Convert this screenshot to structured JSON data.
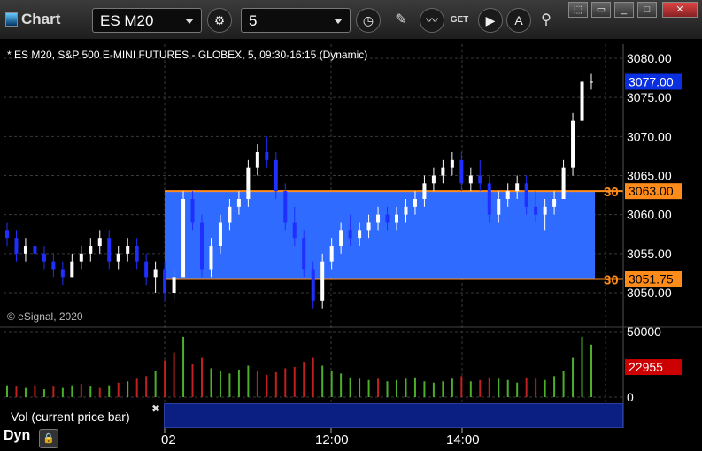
{
  "window": {
    "title": "Chart"
  },
  "toolbar": {
    "symbol": "ES M20",
    "interval": "5",
    "icons": [
      "gear-icon",
      "clock-icon",
      "pencil-icon",
      "line-study-icon",
      "get-icon",
      "play-icon",
      "alert-icon",
      "link-icon"
    ],
    "get_label": "GET"
  },
  "chart": {
    "header": "* ES M20, S&P 500 E-MINI FUTURES - GLOBEX, 5, 09:30-16:15 (Dynamic)",
    "copyright": "© eSignal, 2020",
    "price_axis": [
      "3080.00",
      "3075.00",
      "3070.00",
      "3065.00",
      "3060.00",
      "3055.00",
      "3050.00"
    ],
    "last_price": "3077.00",
    "levels": [
      {
        "left_label": "30",
        "value": "3063.00",
        "color": "#ff8c1a"
      },
      {
        "left_label": "30",
        "value": "3051.75",
        "color": "#ff8c1a"
      }
    ],
    "volume_axis": [
      "50000",
      "0"
    ],
    "volume_value": "22955",
    "time_axis": [
      "02",
      "12:00",
      "14:00"
    ],
    "colors": {
      "up": "#ffffff",
      "down": "#1f2fff",
      "zone": "#2f6bff",
      "last": "#0a2fe0",
      "vol_badge": "#cc0000",
      "vol_up": "#4caf2a",
      "vol_down": "#c02020"
    }
  },
  "chart_data": {
    "type": "candlestick",
    "ylim": [
      3047,
      3082
    ],
    "zone": [
      3051.75,
      3063.0
    ],
    "candles": [
      [
        3058,
        3059,
        3056,
        3057
      ],
      [
        3057,
        3058,
        3054,
        3055
      ],
      [
        3055,
        3057,
        3054,
        3056
      ],
      [
        3056,
        3057,
        3054,
        3055
      ],
      [
        3055,
        3056,
        3053,
        3054
      ],
      [
        3054,
        3055,
        3052,
        3053
      ],
      [
        3053,
        3054,
        3051,
        3052
      ],
      [
        3052,
        3055,
        3052,
        3054
      ],
      [
        3054,
        3056,
        3053,
        3055
      ],
      [
        3055,
        3057,
        3054,
        3056
      ],
      [
        3056,
        3058,
        3055,
        3057
      ],
      [
        3057,
        3058,
        3053,
        3054
      ],
      [
        3054,
        3056,
        3053,
        3055
      ],
      [
        3055,
        3057,
        3054,
        3056
      ],
      [
        3056,
        3057,
        3053,
        3054
      ],
      [
        3054,
        3055,
        3051,
        3052
      ],
      [
        3052,
        3054,
        3050,
        3053
      ],
      [
        3053,
        3054,
        3049,
        3050
      ],
      [
        3050,
        3053,
        3049,
        3052
      ],
      [
        3052,
        3063,
        3052,
        3062
      ],
      [
        3062,
        3063,
        3058,
        3059
      ],
      [
        3059,
        3060,
        3052,
        3053
      ],
      [
        3053,
        3057,
        3052,
        3056
      ],
      [
        3056,
        3060,
        3055,
        3059
      ],
      [
        3059,
        3062,
        3058,
        3061
      ],
      [
        3061,
        3063,
        3060,
        3062
      ],
      [
        3062,
        3067,
        3061,
        3066
      ],
      [
        3066,
        3069,
        3065,
        3068
      ],
      [
        3068,
        3070,
        3066,
        3067
      ],
      [
        3067,
        3068,
        3062,
        3063
      ],
      [
        3063,
        3064,
        3058,
        3059
      ],
      [
        3059,
        3061,
        3056,
        3057
      ],
      [
        3057,
        3058,
        3052,
        3053
      ],
      [
        3053,
        3054,
        3048,
        3049
      ],
      [
        3049,
        3055,
        3048,
        3054
      ],
      [
        3054,
        3057,
        3053,
        3056
      ],
      [
        3056,
        3059,
        3055,
        3058
      ],
      [
        3058,
        3060,
        3056,
        3057
      ],
      [
        3057,
        3059,
        3056,
        3058
      ],
      [
        3058,
        3060,
        3057,
        3059
      ],
      [
        3059,
        3061,
        3058,
        3060
      ],
      [
        3060,
        3061,
        3058,
        3059
      ],
      [
        3059,
        3061,
        3058,
        3060
      ],
      [
        3060,
        3062,
        3059,
        3061
      ],
      [
        3061,
        3063,
        3060,
        3062
      ],
      [
        3062,
        3065,
        3061,
        3064
      ],
      [
        3064,
        3066,
        3063,
        3065
      ],
      [
        3065,
        3067,
        3064,
        3066
      ],
      [
        3066,
        3068,
        3065,
        3067
      ],
      [
        3067,
        3068,
        3063,
        3064
      ],
      [
        3064,
        3066,
        3063,
        3065
      ],
      [
        3065,
        3067,
        3063,
        3064
      ],
      [
        3064,
        3065,
        3059,
        3060
      ],
      [
        3060,
        3063,
        3059,
        3062
      ],
      [
        3062,
        3064,
        3061,
        3063
      ],
      [
        3063,
        3065,
        3062,
        3064
      ],
      [
        3064,
        3065,
        3060,
        3061
      ],
      [
        3061,
        3063,
        3059,
        3060
      ],
      [
        3060,
        3062,
        3058,
        3061
      ],
      [
        3061,
        3063,
        3060,
        3062
      ],
      [
        3062,
        3067,
        3062,
        3066
      ],
      [
        3066,
        3073,
        3065,
        3072
      ],
      [
        3072,
        3078,
        3071,
        3077
      ],
      [
        3077,
        3078,
        3076,
        3077
      ]
    ],
    "volume": [
      [
        9000,
        1
      ],
      [
        8000,
        0
      ],
      [
        7000,
        1
      ],
      [
        9000,
        0
      ],
      [
        6000,
        1
      ],
      [
        8000,
        0
      ],
      [
        7000,
        1
      ],
      [
        9000,
        1
      ],
      [
        10000,
        0
      ],
      [
        8000,
        1
      ],
      [
        7000,
        0
      ],
      [
        9000,
        1
      ],
      [
        11000,
        0
      ],
      [
        12000,
        1
      ],
      [
        14000,
        0
      ],
      [
        16000,
        0
      ],
      [
        20000,
        1
      ],
      [
        28000,
        0
      ],
      [
        34000,
        0
      ],
      [
        46000,
        1
      ],
      [
        25000,
        0
      ],
      [
        30000,
        0
      ],
      [
        22000,
        1
      ],
      [
        20000,
        1
      ],
      [
        18000,
        1
      ],
      [
        21000,
        1
      ],
      [
        24000,
        1
      ],
      [
        20000,
        0
      ],
      [
        17000,
        0
      ],
      [
        19000,
        0
      ],
      [
        22000,
        0
      ],
      [
        23000,
        0
      ],
      [
        27000,
        0
      ],
      [
        30000,
        0
      ],
      [
        24000,
        1
      ],
      [
        20000,
        1
      ],
      [
        18000,
        1
      ],
      [
        15000,
        1
      ],
      [
        14000,
        1
      ],
      [
        13000,
        1
      ],
      [
        14000,
        0
      ],
      [
        12000,
        1
      ],
      [
        13000,
        1
      ],
      [
        14000,
        1
      ],
      [
        15000,
        1
      ],
      [
        12000,
        1
      ],
      [
        11000,
        1
      ],
      [
        12000,
        1
      ],
      [
        14000,
        1
      ],
      [
        16000,
        0
      ],
      [
        12000,
        1
      ],
      [
        13000,
        0
      ],
      [
        15000,
        0
      ],
      [
        14000,
        1
      ],
      [
        13000,
        1
      ],
      [
        11000,
        1
      ],
      [
        15000,
        0
      ],
      [
        14000,
        0
      ],
      [
        13000,
        1
      ],
      [
        16000,
        1
      ],
      [
        20000,
        1
      ],
      [
        30000,
        1
      ],
      [
        46000,
        1
      ],
      [
        40000,
        1
      ]
    ]
  }
}
